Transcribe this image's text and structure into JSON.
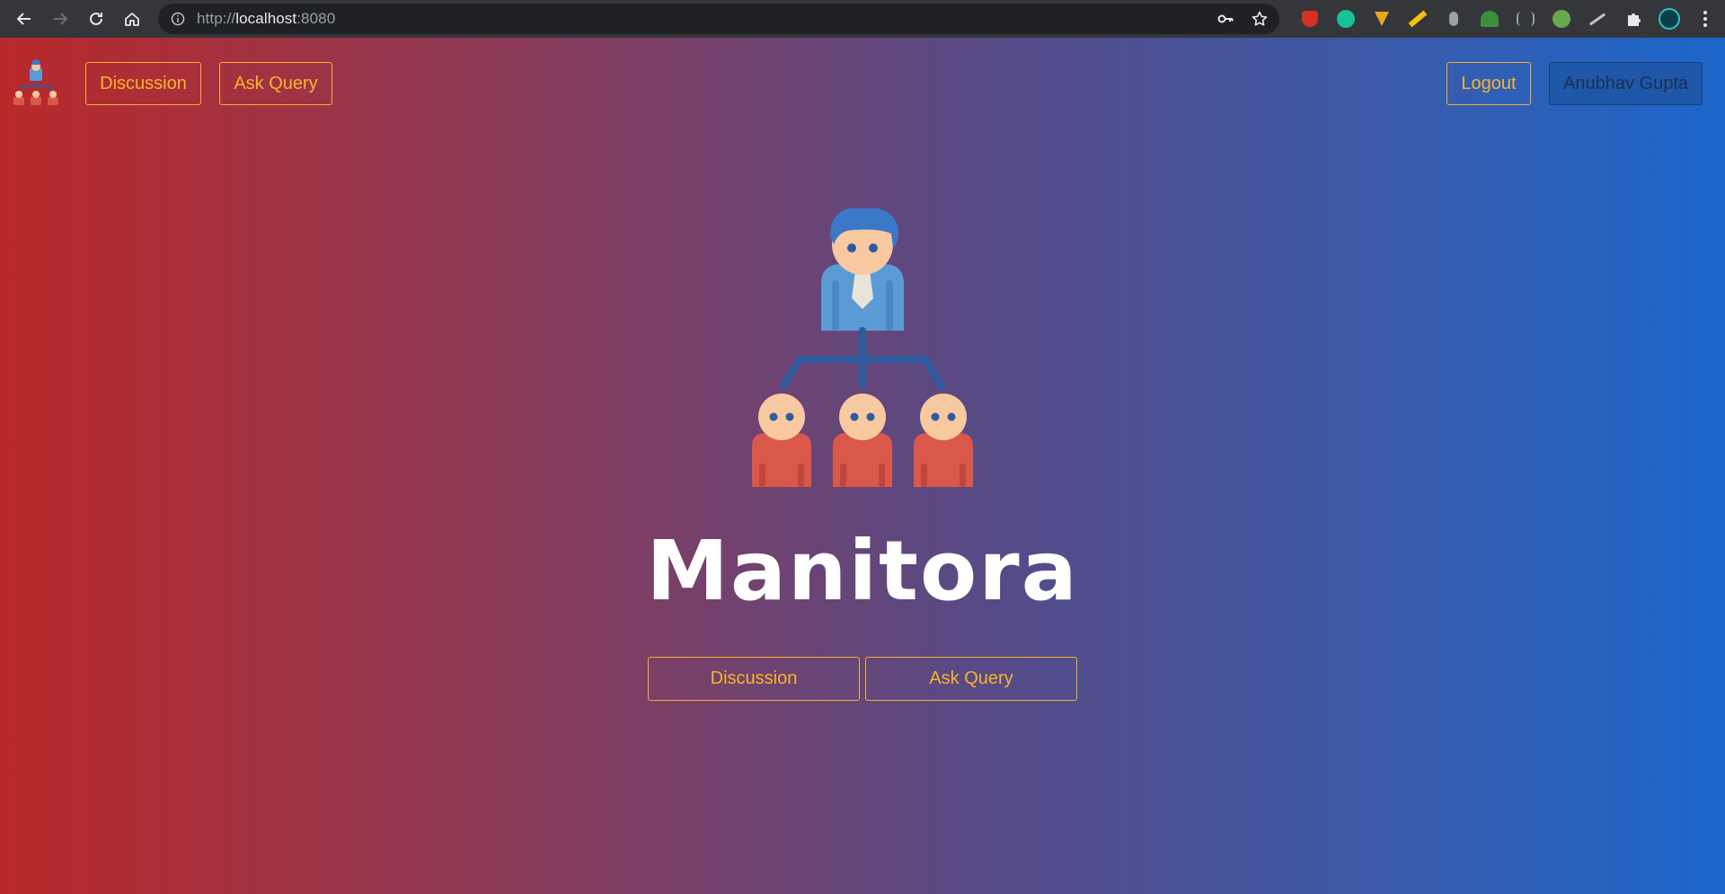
{
  "browser": {
    "url_scheme": "http://",
    "url_host": "localhost",
    "url_port": ":8080",
    "icons": {
      "back": "arrow-left-icon",
      "forward": "arrow-right-icon",
      "reload": "reload-icon",
      "home": "home-icon",
      "site_info": "info-icon",
      "password": "key-icon",
      "bookmark": "star-icon",
      "extensions": "puzzle-icon",
      "menu": "kebab-menu-icon"
    }
  },
  "navbar": {
    "discussion_label": "Discussion",
    "ask_query_label": "Ask Query",
    "logout_label": "Logout",
    "user_name": "Anubhav Gupta"
  },
  "hero": {
    "brand_title": "Manitora",
    "discussion_label": "Discussion",
    "ask_query_label": "Ask Query"
  },
  "colors": {
    "accent": "#f7b52c",
    "gradient_left": "#b9292a",
    "gradient_right": "#1b66cb",
    "chrome_bg": "#35363a",
    "omnibox_bg": "#202124"
  }
}
